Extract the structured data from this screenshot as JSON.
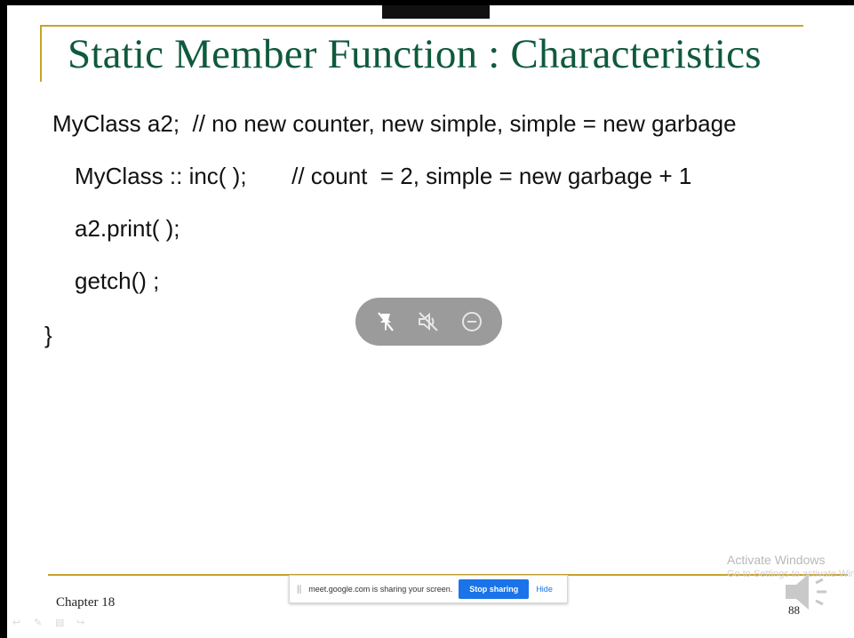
{
  "slide": {
    "title": "Static Member Function : Characteristics",
    "code_lines": [
      "MyClass a2;  // no new counter, new simple, simple = new garbage",
      "MyClass :: inc( );       // count  = 2, simple = new garbage + 1",
      "a2.print( );",
      "getch() ;",
      "}"
    ],
    "footer_left": "Chapter 18",
    "page_number": "88"
  },
  "watermark": {
    "line1": "Activate Windows",
    "line2": "Go to Settings to activate Windows."
  },
  "screen_share_bar": {
    "message": "meet.google.com is sharing your screen.",
    "stop_label": "Stop sharing",
    "hide_label": "Hide"
  },
  "meet_controls": {
    "icons": [
      "unpin-icon",
      "mute-audio-icon",
      "remove-icon"
    ]
  },
  "colors": {
    "title_green": "#0f5a3c",
    "rule_gold": "#c9a22a",
    "meet_bar_gray": "#9b9b9b",
    "share_blue": "#1a73e8"
  }
}
